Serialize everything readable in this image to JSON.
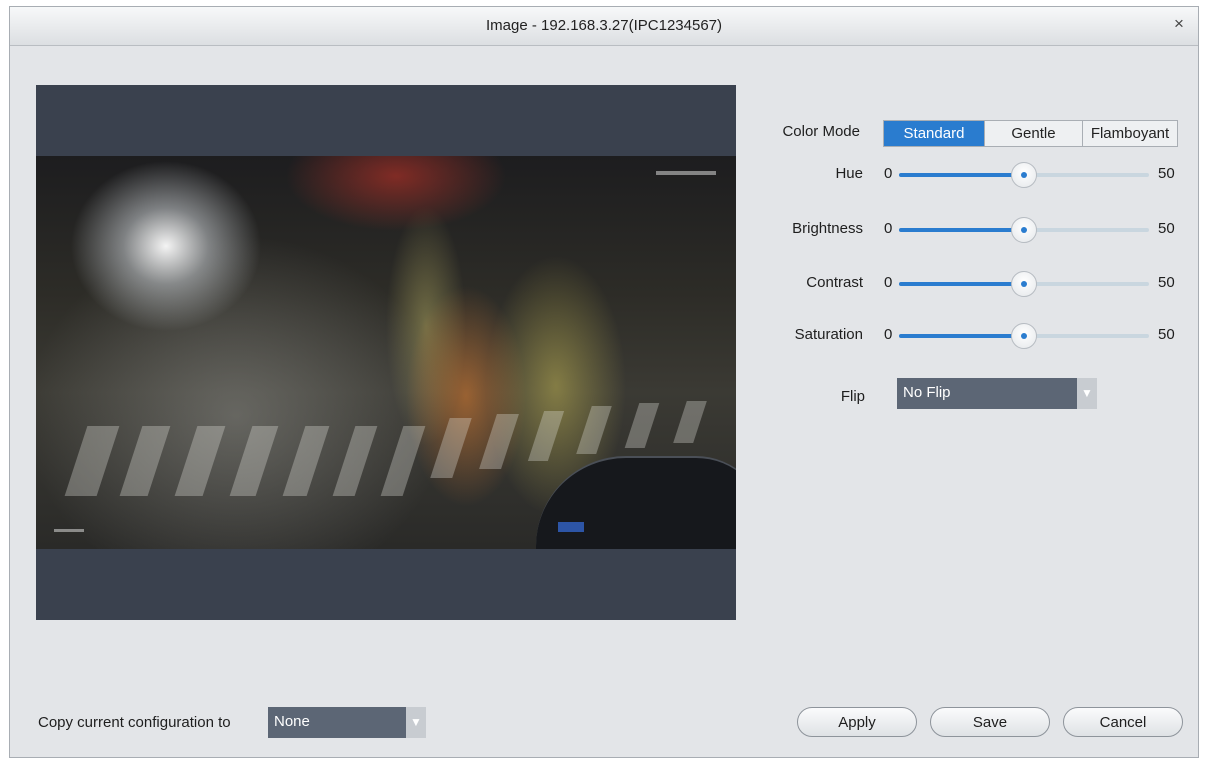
{
  "window": {
    "title": "Image - 192.168.3.27(IPC1234567)",
    "close_glyph": "×"
  },
  "settings": {
    "color_mode": {
      "label": "Color Mode",
      "options": [
        "Standard",
        "Gentle",
        "Flamboyant"
      ],
      "selected": "Standard"
    },
    "sliders": [
      {
        "label": "Hue",
        "min_label": "0",
        "value_label": "50",
        "value": 50,
        "max": 100
      },
      {
        "label": "Brightness",
        "min_label": "0",
        "value_label": "50",
        "value": 50,
        "max": 100
      },
      {
        "label": "Contrast",
        "min_label": "0",
        "value_label": "50",
        "value": 50,
        "max": 100
      },
      {
        "label": "Saturation",
        "min_label": "0",
        "value_label": "50",
        "value": 50,
        "max": 100
      }
    ],
    "flip": {
      "label": "Flip",
      "value": "No Flip"
    }
  },
  "footer": {
    "copy_label": "Copy current configuration to",
    "copy_value": "None",
    "apply_label": "Apply",
    "save_label": "Save",
    "cancel_label": "Cancel"
  },
  "colors": {
    "accent": "#2a7ccf",
    "dialog_bg": "#e3e5e8",
    "preview_bg": "#3a414e",
    "select_bg": "#5c6675"
  },
  "icons": {
    "close": "close-icon",
    "dropdown": "chevron-down-icon"
  }
}
